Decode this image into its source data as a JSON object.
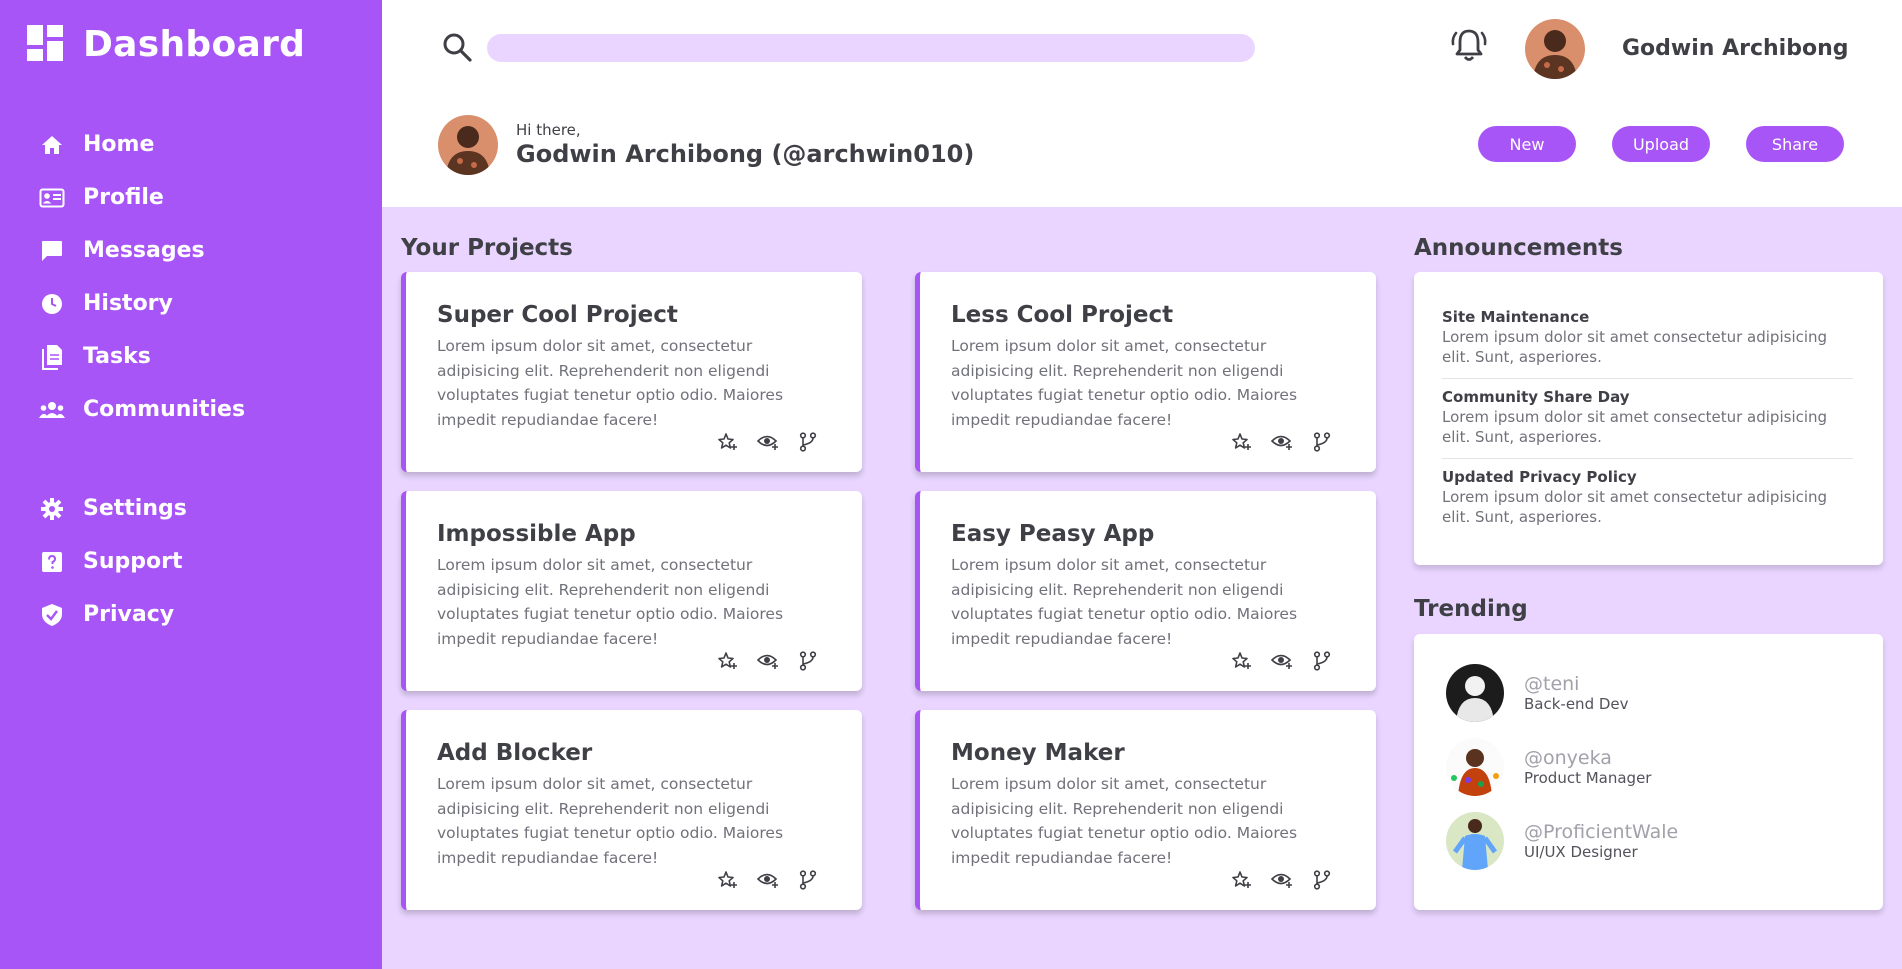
{
  "sidebar": {
    "brand": "Dashboard",
    "nav": [
      {
        "label": "Home",
        "icon": "home-icon"
      },
      {
        "label": "Profile",
        "icon": "id-card-icon"
      },
      {
        "label": "Messages",
        "icon": "chat-icon"
      },
      {
        "label": "History",
        "icon": "clock-icon"
      },
      {
        "label": "Tasks",
        "icon": "document-icon"
      },
      {
        "label": "Communities",
        "icon": "people-icon"
      }
    ],
    "nav2": [
      {
        "label": "Settings",
        "icon": "gear-icon"
      },
      {
        "label": "Support",
        "icon": "help-icon"
      },
      {
        "label": "Privacy",
        "icon": "shield-icon"
      }
    ]
  },
  "header": {
    "search_placeholder": "",
    "user_name": "Godwin Archibong",
    "greeting_small": "Hi there,",
    "greeting_name": "Godwin Archibong (@archwin010)",
    "buttons": {
      "new": "New",
      "upload": "Upload",
      "share": "Share"
    }
  },
  "projects": {
    "title": "Your Projects",
    "items": [
      {
        "title": "Super Cool Project",
        "desc": "Lorem ipsum dolor sit amet, consectetur adipisicing elit. Reprehenderit non eligendi voluptates fugiat tenetur optio odio. Maiores impedit repudiandae facere!"
      },
      {
        "title": "Less Cool Project",
        "desc": "Lorem ipsum dolor sit amet, consectetur adipisicing elit. Reprehenderit non eligendi voluptates fugiat tenetur optio odio. Maiores impedit repudiandae facere!"
      },
      {
        "title": "Impossible App",
        "desc": "Lorem ipsum dolor sit amet, consectetur adipisicing elit. Reprehenderit non eligendi voluptates fugiat tenetur optio odio. Maiores impedit repudiandae facere!"
      },
      {
        "title": "Easy Peasy App",
        "desc": "Lorem ipsum dolor sit amet, consectetur adipisicing elit. Reprehenderit non eligendi voluptates fugiat tenetur optio odio. Maiores impedit repudiandae facere!"
      },
      {
        "title": "Add Blocker",
        "desc": "Lorem ipsum dolor sit amet, consectetur adipisicing elit. Reprehenderit non eligendi voluptates fugiat tenetur optio odio. Maiores impedit repudiandae facere!"
      },
      {
        "title": "Money Maker",
        "desc": "Lorem ipsum dolor sit amet, consectetur adipisicing elit. Reprehenderit non eligendi voluptates fugiat tenetur optio odio. Maiores impedit repudiandae facere!"
      }
    ]
  },
  "announcements": {
    "title": "Announcements",
    "items": [
      {
        "title": "Site Maintenance",
        "desc": "Lorem ipsum dolor sit amet consectetur adipisicing elit. Sunt, asperiores."
      },
      {
        "title": "Community Share Day",
        "desc": "Lorem ipsum dolor sit amet consectetur adipisicing elit. Sunt, asperiores."
      },
      {
        "title": "Updated Privacy Policy",
        "desc": "Lorem ipsum dolor sit amet consectetur adipisicing elit. Sunt, asperiores."
      }
    ]
  },
  "trending": {
    "title": "Trending",
    "items": [
      {
        "handle": "@teni",
        "role": "Back-end Dev"
      },
      {
        "handle": "@onyeka",
        "role": "Product Manager"
      },
      {
        "handle": "@ProficientWale",
        "role": "UI/UX Designer"
      }
    ]
  },
  "colors": {
    "accent": "#a855f7",
    "light_accent": "#e9d5ff",
    "text": "#3f3f46"
  }
}
